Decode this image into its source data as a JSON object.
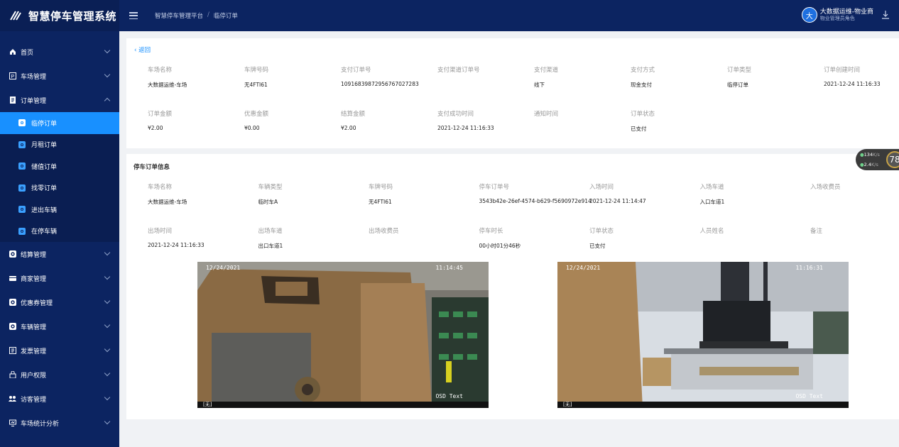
{
  "app": {
    "title": "智慧停车管理系统"
  },
  "header": {
    "breadcrumb": [
      "智慧停车管理平台",
      "/",
      "临停订单"
    ],
    "user_name": "大数据运维-物业商",
    "user_role": "物业管理员角色",
    "avatar_text": "大"
  },
  "sidebar": {
    "items": [
      {
        "label": "首页",
        "icon": "home-icon"
      },
      {
        "label": "车场管理",
        "icon": "parking-icon"
      },
      {
        "label": "订单管理",
        "icon": "order-icon",
        "expanded": true
      },
      {
        "label": "结算管理",
        "icon": "settlement-icon"
      },
      {
        "label": "商家管理",
        "icon": "merchant-icon"
      },
      {
        "label": "优惠券管理",
        "icon": "coupon-icon"
      },
      {
        "label": "车辆管理",
        "icon": "vehicle-icon"
      },
      {
        "label": "发票管理",
        "icon": "invoice-icon"
      },
      {
        "label": "用户权限",
        "icon": "lock-icon"
      },
      {
        "label": "访客管理",
        "icon": "visitor-icon"
      },
      {
        "label": "车场统计分析",
        "icon": "stats-icon"
      }
    ],
    "sub_items": [
      {
        "label": "临停订单",
        "active": true
      },
      {
        "label": "月租订单"
      },
      {
        "label": "储值订单"
      },
      {
        "label": "找零订单"
      },
      {
        "label": "进出车辆"
      },
      {
        "label": "在停车辆"
      }
    ]
  },
  "order": {
    "back": "返回",
    "fields": [
      {
        "label": "车场名称",
        "value": "大数据运维-车场"
      },
      {
        "label": "车牌号码",
        "value": "无4FTI61"
      },
      {
        "label": "支付订单号",
        "value": "10916839872956767027283"
      },
      {
        "label": "支付渠道订单号",
        "value": ""
      },
      {
        "label": "支付渠道",
        "value": "线下"
      },
      {
        "label": "支付方式",
        "value": "现金支付"
      },
      {
        "label": "订单类型",
        "value": "临停订单"
      },
      {
        "label": "订单创建时间",
        "value": "2021-12-24 11:16:33"
      },
      {
        "label": "订单金额",
        "value": "¥2.00"
      },
      {
        "label": "优惠金额",
        "value": "¥0.00"
      },
      {
        "label": "结算金额",
        "value": "¥2.00"
      },
      {
        "label": "支付成功时间",
        "value": "2021-12-24 11:16:33"
      },
      {
        "label": "通知时间",
        "value": ""
      },
      {
        "label": "订单状态",
        "value": "已支付"
      }
    ]
  },
  "parking": {
    "title": "停车订单信息",
    "fields": [
      {
        "label": "车场名称",
        "value": "大数据运维-车场"
      },
      {
        "label": "车辆类型",
        "value": "临时车A"
      },
      {
        "label": "车牌号码",
        "value": "无4FTI61"
      },
      {
        "label": "停车订单号",
        "value": "3543b42e-26ef-4574-b629-f5690972e914"
      },
      {
        "label": "入场时间",
        "value": "2021-12-24 11:14:47"
      },
      {
        "label": "入场车道",
        "value": "入口车道1"
      },
      {
        "label": "入场收费员",
        "value": ""
      },
      {
        "label": "出场时间",
        "value": "2021-12-24 11:16:33"
      },
      {
        "label": "出场车道",
        "value": "出口车道1"
      },
      {
        "label": "出场收费员",
        "value": ""
      },
      {
        "label": "停车时长",
        "value": "00小时01分46秒"
      },
      {
        "label": "订单状态",
        "value": "已支付"
      },
      {
        "label": "人员姓名",
        "value": ""
      },
      {
        "label": "备注",
        "value": ""
      }
    ],
    "images": [
      {
        "date": "12/24/2021",
        "time": "11:14:45",
        "osd": "OSD Text",
        "footer": "[无]"
      },
      {
        "date": "12/24/2021",
        "time": "11:16:31",
        "osd": "OSD Text",
        "footer": "[无]"
      }
    ]
  },
  "speed_widget": {
    "up": "134",
    "up_unit": "K/s",
    "down": "2.4",
    "down_unit": "K/s",
    "value": "78"
  }
}
